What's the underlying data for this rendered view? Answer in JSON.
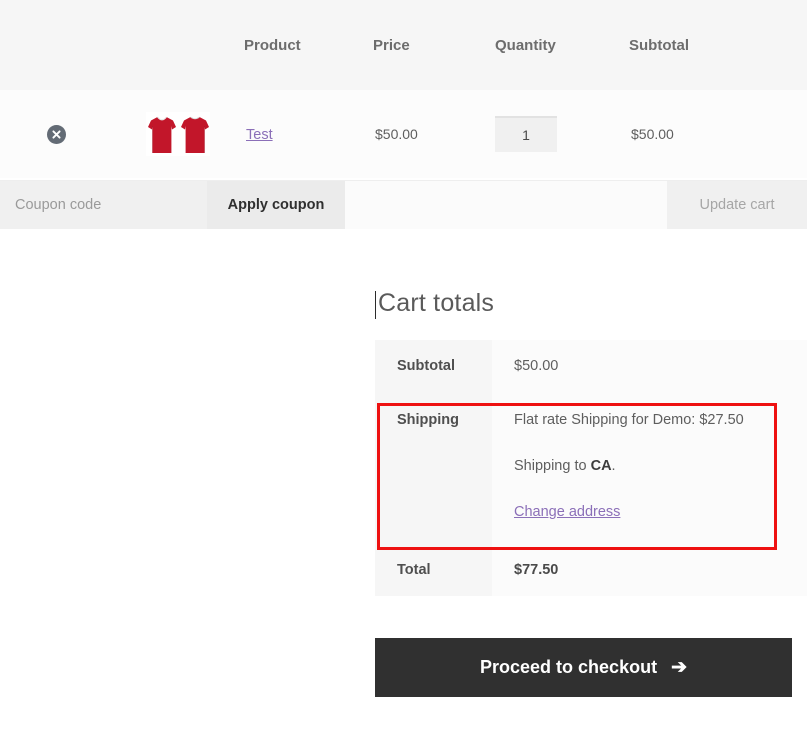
{
  "cart_table": {
    "headers": {
      "remove": "",
      "thumbnail": "",
      "product": "Product",
      "price": "Price",
      "quantity": "Quantity",
      "subtotal": "Subtotal"
    },
    "rows": [
      {
        "remove_icon": "remove-circle-x-icon",
        "thumbnail_icon": "red-tshirt-pair-thumbnail",
        "product_name": "Test",
        "price": "$50.00",
        "quantity": "1",
        "subtotal": "$50.00"
      }
    ]
  },
  "coupon": {
    "placeholder": "Coupon code",
    "value": "",
    "apply_label": "Apply coupon",
    "update_cart_label": "Update cart"
  },
  "totals": {
    "heading": "Cart totals",
    "subtotal_label": "Subtotal",
    "subtotal_value": "$50.00",
    "shipping_label": "Shipping",
    "shipping_method": "Flat rate Shipping for Demo: $27.50",
    "shipping_to_prefix": "Shipping to ",
    "shipping_to_location": "CA",
    "shipping_to_suffix": ".",
    "change_address_label": "Change address",
    "total_label": "Total",
    "total_value": "$77.50"
  },
  "checkout": {
    "label": "Proceed to checkout",
    "arrow": "➔"
  },
  "colors": {
    "link_purple": "#8b6fb8",
    "annotation_red": "#ee1111",
    "checkout_dark": "#303030",
    "shirt_red": "#c2162a"
  }
}
